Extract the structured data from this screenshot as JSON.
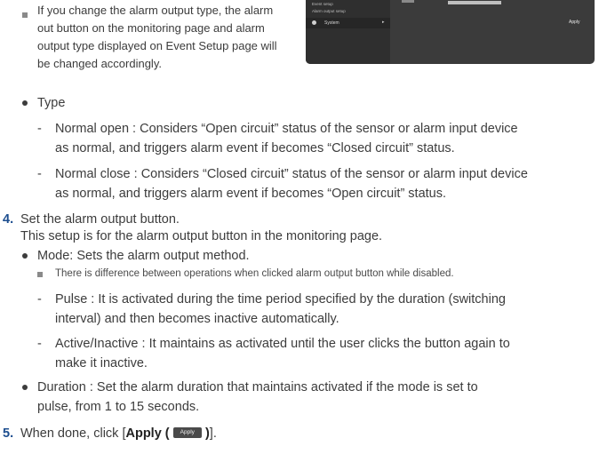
{
  "note_top": {
    "line0": "",
    "lines": [
      "If you change the alarm output type, the alarm",
      "out button on the monitoring page and alarm",
      "output type displayed on Event Setup page will",
      "be changed accordingly."
    ]
  },
  "screenshot": {
    "menu_items": [
      "Event setup",
      "Alarm output setup"
    ],
    "system_label": "System",
    "system_arrow": "▸",
    "apply_label": "Apply"
  },
  "type_section": {
    "bullet": "Type",
    "normal_open": "Normal open : Considers “Open circuit” status of the sensor or alarm input device",
    "normal_open_cont": "as normal, and triggers alarm event if becomes “Closed circuit” status.",
    "normal_close": "Normal close : Considers “Closed circuit” status of the sensor or alarm input device",
    "normal_close_cont": "as normal, and triggers alarm event if becomes “Open circuit” status."
  },
  "step4": {
    "number": "4.",
    "title": "Set the alarm output button.",
    "desc": "This setup is for the alarm output button in the monitoring page.",
    "mode": "Mode: Sets the alarm output method.",
    "mode_note": "There is difference between operations when clicked alarm output button while disabled.",
    "pulse": "Pulse : It is activated during the time period specified by the duration (switching",
    "pulse_cont": "interval) and then becomes inactive automatically.",
    "active": "Active/Inactive : It maintains as activated until the user clicks the button again to",
    "active_cont": "make it inactive.",
    "duration": "Duration : Set the alarm duration that maintains activated if the mode is set to",
    "duration_cont": "pulse, from 1 to 15 seconds."
  },
  "step5": {
    "number": "5.",
    "before": "When done, click [",
    "bold": "Apply (",
    "button": "Apply",
    "bold_after": ")",
    "after": "]."
  },
  "dash": "-"
}
